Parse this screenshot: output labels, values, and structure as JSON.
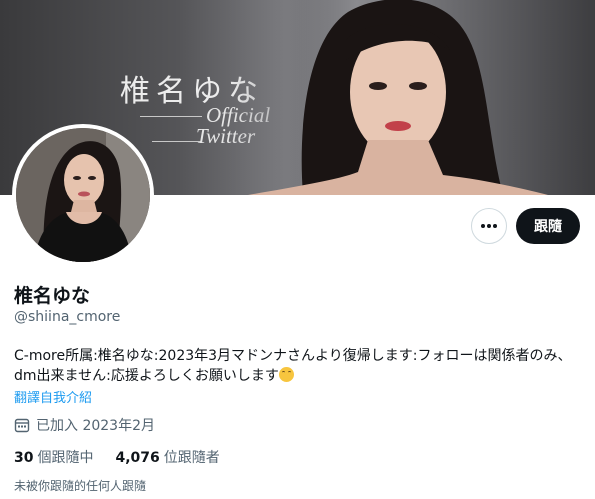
{
  "banner": {
    "title": "椎名ゆな",
    "subtitle_line1": "Official",
    "subtitle_line2": "Twitter"
  },
  "profile": {
    "name": "椎名ゆな",
    "handle": "@shiina_cmore",
    "bio": "C-more所属:椎名ゆな:2023年3月マドンナさんより復帰します:フォローは関係者のみ、dm出来ません:応援よろしくお願いします",
    "bio_emoji": "smiling-face-emoji",
    "translate_label": "翻譯自我介紹",
    "joined": "已加入 2023年2月"
  },
  "actions": {
    "more_icon": "more-dots-icon",
    "follow_label": "跟隨"
  },
  "stats": {
    "following_count": "30",
    "following_label": "個跟隨中",
    "followers_count": "4,076",
    "followers_label": "位跟隨者"
  },
  "note": "未被你跟隨的任何人跟隨",
  "colors": {
    "accent_link": "#1d9bf0",
    "primary_button": "#0f1419",
    "secondary_text": "#536471"
  }
}
